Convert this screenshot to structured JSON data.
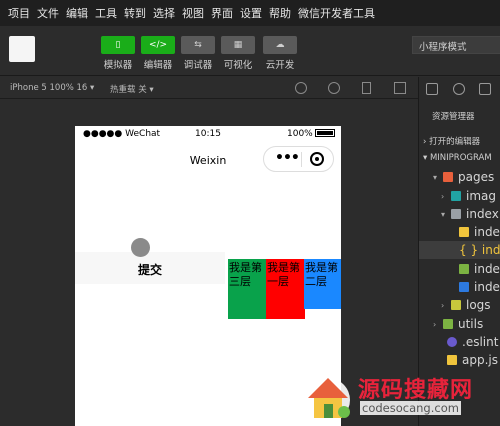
{
  "menu": [
    "项目",
    "文件",
    "编辑",
    "工具",
    "转到",
    "选择",
    "视图",
    "界面",
    "设置",
    "帮助",
    "微信开发者工具"
  ],
  "toolbar": {
    "buttons": [
      {
        "label": "模拟器",
        "icon": "phone-icon",
        "glyph": "▯",
        "style": "green"
      },
      {
        "label": "编辑器",
        "icon": "code-icon",
        "glyph": "</>",
        "style": "green"
      },
      {
        "label": "调试器",
        "icon": "debug-icon",
        "glyph": "⇆",
        "style": "gray"
      },
      {
        "label": "可视化",
        "icon": "layout-icon",
        "glyph": "▦",
        "style": "gray"
      },
      {
        "label": "云开发",
        "icon": "cloud-icon",
        "glyph": "☁",
        "style": "gray"
      }
    ],
    "mode": "小程序模式"
  },
  "subbar": {
    "device": "iPhone 5 100% 16 ▾",
    "hot_reload": "热重载 关 ▾"
  },
  "phone": {
    "carrier": "●●●●● WeChat",
    "time": "10:15",
    "battery": "100%",
    "nav_title": "Weixin",
    "submit": "提交",
    "layers": [
      "我是第三层",
      "我是第一层",
      "我是第二层"
    ]
  },
  "sidebar": {
    "title": "资源管理器",
    "open_editors": "› 打开的编辑器",
    "project": "▾ MINIPROGRAM",
    "tree": [
      {
        "label": "pages",
        "arrow": "▾",
        "color": "#e8603c"
      },
      {
        "label": "imag",
        "arrow": "›",
        "color": "#21a3a3"
      },
      {
        "label": "index",
        "arrow": "▾",
        "color": "#9aa0a6"
      },
      {
        "label": "inde",
        "arrow": "",
        "color": "#f0c43c"
      },
      {
        "label": "{ } inde",
        "arrow": "",
        "color": ""
      },
      {
        "label": "inde",
        "arrow": "",
        "color": "#7cb342"
      },
      {
        "label": "inde",
        "arrow": "",
        "color": "#2d7ae0"
      },
      {
        "label": "logs",
        "arrow": "›",
        "color": "#c8c83c"
      },
      {
        "label": "utils",
        "arrow": "›",
        "color": "#7cb342"
      },
      {
        "label": ".eslint",
        "arrow": "",
        "color": "#6a5acd"
      },
      {
        "label": "app.js",
        "arrow": "",
        "color": "#f0c43c"
      }
    ]
  },
  "watermark": {
    "title": "源码搜藏网",
    "url": "codesocang.com"
  }
}
